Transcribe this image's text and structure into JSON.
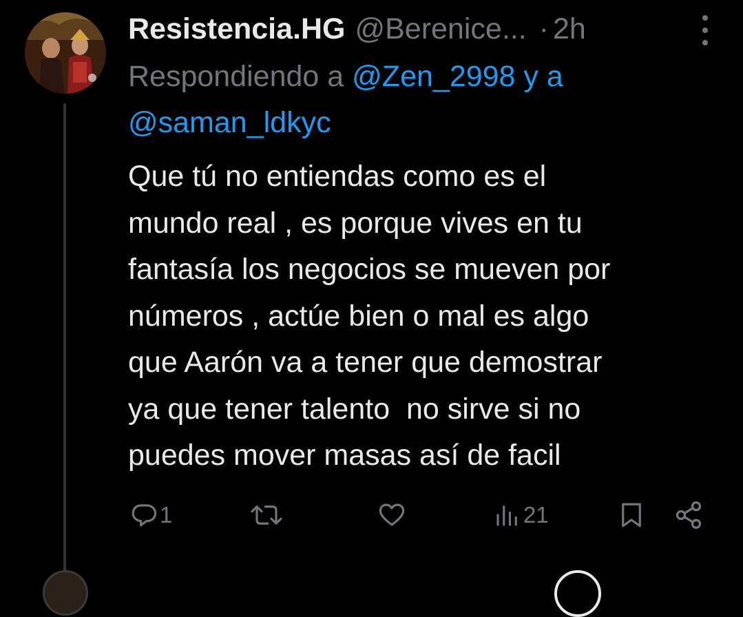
{
  "tweet": {
    "display_name": "Resistencia.HG",
    "handle": "@Berenice...",
    "separator": "·",
    "time": "2h",
    "avatar_icon": "profile-photo",
    "reply": {
      "prefix": "Respondiendo a ",
      "mention_1": "@Zen_2998",
      "connector": " y a ",
      "mention_2": "@saman_ldkyc"
    },
    "text": "Que tú no entiendas como es el\nmundo real , es porque vives en tu\nfantasía los negocios se mueven por\nnúmeros , actúe bien o mal es algo\nque Aarón va a tener que demostrar\nya que tener talento  no sirve si no\npuedes mover masas así de facil"
  },
  "actions": {
    "reply_count": "1",
    "retweet_count": "",
    "like_count": "",
    "views_count": "21"
  },
  "colors": {
    "background": "#000000",
    "primary_text": "#e7e9ea",
    "secondary_text": "#71767b",
    "accent": "#1d9bf0",
    "thread_line": "#333639"
  }
}
